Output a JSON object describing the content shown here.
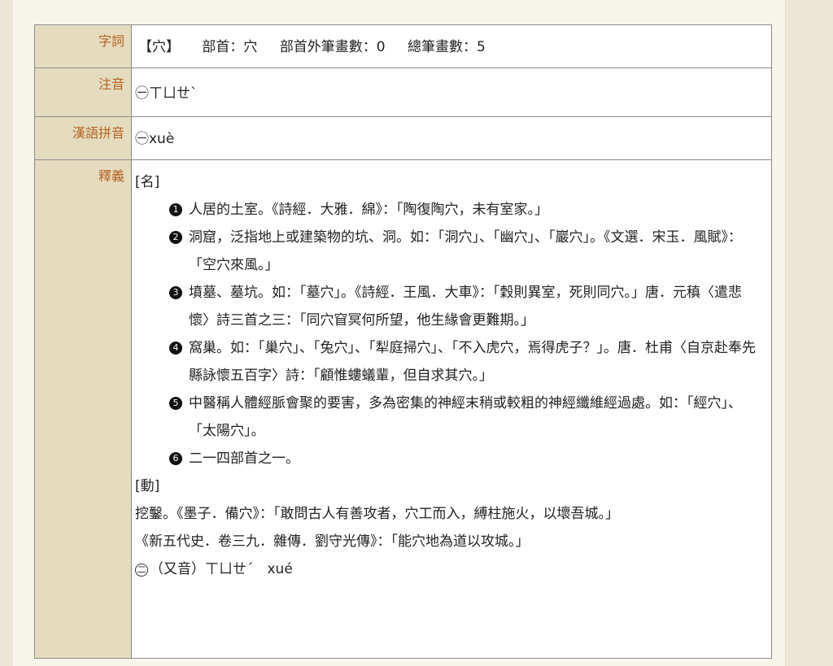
{
  "labels": {
    "term": "字詞",
    "zhuyin": "注音",
    "pinyin": "漢語拼音",
    "definition": "釋義"
  },
  "term": {
    "char": "【穴】",
    "radical": "部首：穴",
    "strokes_outside": "部首外筆畫數：0",
    "total_strokes": "總筆畫數：5"
  },
  "zhuyin": "㊀ㄒㄩㄝˋ",
  "pinyin": "㊀xuè",
  "definitions": {
    "noun_tag": "[名]",
    "noun_senses": [
      {
        "num": "1",
        "text": "人居的土室。《詩經．大雅．綿》：「陶復陶穴，未有室家。」"
      },
      {
        "num": "2",
        "text": "洞窟，泛指地上或建築物的坑、洞。如：「洞穴」、「幽穴」、「巖穴」。《文選．宋玉．風賦》：「空穴來風。」"
      },
      {
        "num": "3",
        "text": "墳墓、墓坑。如：「墓穴」。《詩經．王風．大車》：「穀則異室，死則同穴。」唐．元稹〈遣悲懷〉詩三首之三：「同穴窅冥何所望，他生緣會更難期。」"
      },
      {
        "num": "4",
        "text": "窩巢。如：「巢穴」、「兔穴」、「犁庭掃穴」、「不入虎穴，焉得虎子？」。唐．杜甫〈自京赴奉先縣詠懷五百字〉詩：「顧惟螻蟻輩，但自求其穴。」"
      },
      {
        "num": "5",
        "text": "中醫稱人體經脈會聚的要害，多為密集的神經末稍或較粗的神經纖維經過處。如：「經穴」、「太陽穴」。"
      },
      {
        "num": "6",
        "text": "二一四部首之一。"
      }
    ],
    "verb_tag": "[動]",
    "verb_line1": "挖鑿。《墨子．備穴》：「敢問古人有善攻者，穴工而入，縛柱施火，以壞吾城。」",
    "verb_line2": "《新五代史．卷三九．雜傳．劉守光傳》：「能穴地為道以攻城。」",
    "alt_num": "二",
    "alt_text": "（又音）ㄒㄩㄝˊ　xué"
  }
}
